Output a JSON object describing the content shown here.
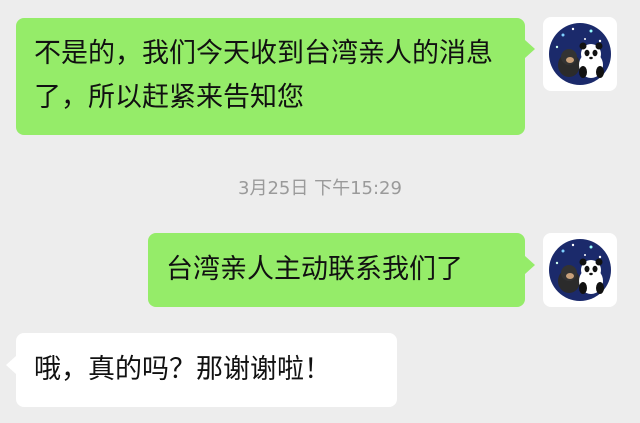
{
  "messages": [
    {
      "side": "sent",
      "text": "不是的，我们今天收到台湾亲人的消息了，所以赶紧来告知您"
    },
    {
      "side": "sent",
      "text": "台湾亲人主动联系我们了"
    },
    {
      "side": "received",
      "text": "哦，真的吗？那谢谢啦！"
    }
  ],
  "timestamp": "3月25日 下午15:29",
  "avatar": {
    "icon": "panda-avatar-icon"
  },
  "colors": {
    "sent_bubble": "#95ec69",
    "received_bubble": "#ffffff",
    "background": "#ededed"
  }
}
